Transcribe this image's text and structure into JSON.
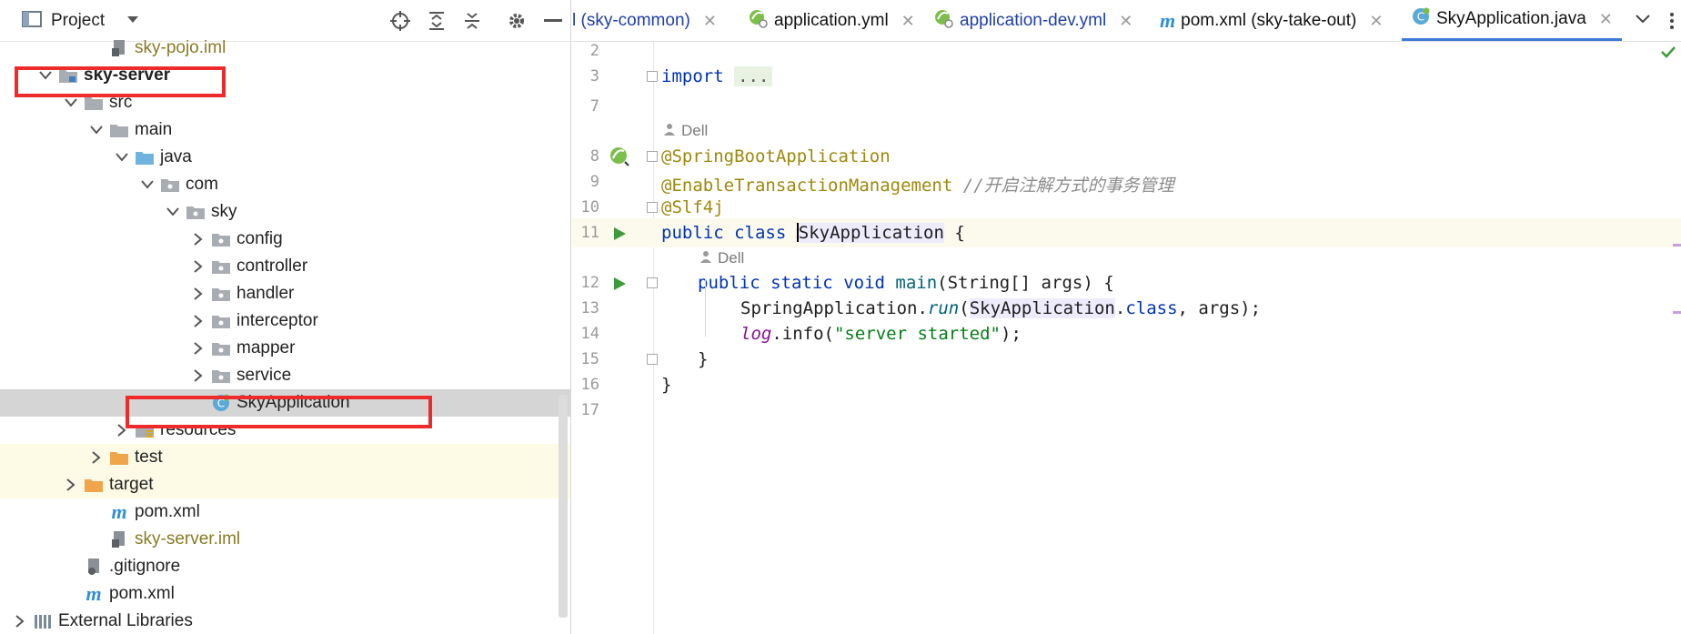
{
  "project_panel": {
    "title": "Project"
  },
  "tree": [
    {
      "label": "sky-pojo.iml",
      "depth": 3,
      "icon": "iml-file-icon",
      "expand": "none",
      "style": "olive"
    },
    {
      "label": "sky-server",
      "depth": 1,
      "icon": "module-folder-icon",
      "expand": "open",
      "style": "bold"
    },
    {
      "label": "src",
      "depth": 2,
      "icon": "folder-icon",
      "expand": "open",
      "style": "normal"
    },
    {
      "label": "main",
      "depth": 3,
      "icon": "folder-icon",
      "expand": "open",
      "style": "normal"
    },
    {
      "label": "java",
      "depth": 4,
      "icon": "source-folder-icon",
      "expand": "open",
      "style": "normal"
    },
    {
      "label": "com",
      "depth": 5,
      "icon": "package-icon",
      "expand": "open",
      "style": "normal"
    },
    {
      "label": "sky",
      "depth": 6,
      "icon": "package-icon",
      "expand": "open",
      "style": "normal"
    },
    {
      "label": "config",
      "depth": 7,
      "icon": "package-icon",
      "expand": "closed",
      "style": "normal"
    },
    {
      "label": "controller",
      "depth": 7,
      "icon": "package-icon",
      "expand": "closed",
      "style": "normal"
    },
    {
      "label": "handler",
      "depth": 7,
      "icon": "package-icon",
      "expand": "closed",
      "style": "normal"
    },
    {
      "label": "interceptor",
      "depth": 7,
      "icon": "package-icon",
      "expand": "closed",
      "style": "normal"
    },
    {
      "label": "mapper",
      "depth": 7,
      "icon": "package-icon",
      "expand": "closed",
      "style": "normal"
    },
    {
      "label": "service",
      "depth": 7,
      "icon": "package-icon",
      "expand": "closed",
      "style": "normal"
    },
    {
      "label": "SkyApplication",
      "depth": 7,
      "icon": "spring-class-icon",
      "expand": "none",
      "style": "normal",
      "selected": true
    },
    {
      "label": "resources",
      "depth": 4,
      "icon": "resources-folder-icon",
      "expand": "closed",
      "style": "normal"
    },
    {
      "label": "test",
      "depth": 3,
      "icon": "orange-folder-icon",
      "expand": "closed",
      "style": "normal",
      "yellow": true
    },
    {
      "label": "target",
      "depth": 2,
      "icon": "orange-folder-icon",
      "expand": "closed",
      "style": "normal",
      "yellow": true
    },
    {
      "label": "pom.xml",
      "depth": 3,
      "icon": "maven-icon",
      "expand": "none",
      "style": "normal"
    },
    {
      "label": "sky-server.iml",
      "depth": 3,
      "icon": "iml-file-icon",
      "expand": "none",
      "style": "olive"
    },
    {
      "label": ".gitignore",
      "depth": 2,
      "icon": "gitignore-icon",
      "expand": "none",
      "style": "normal"
    },
    {
      "label": "pom.xml",
      "depth": 2,
      "icon": "maven-icon",
      "expand": "none",
      "style": "normal"
    },
    {
      "label": "External Libraries",
      "depth": 0,
      "icon": "library-icon",
      "expand": "closed",
      "style": "normal"
    }
  ],
  "tabs": [
    {
      "label": "l (sky-common)",
      "icon": "",
      "active": false
    },
    {
      "label": "application.yml",
      "icon": "spring-yml-icon",
      "active": false
    },
    {
      "label": "application-dev.yml",
      "icon": "spring-yml-icon",
      "active": false
    },
    {
      "label": "pom.xml (sky-take-out)",
      "icon": "maven-icon",
      "active": false
    },
    {
      "label": "SkyApplication.java",
      "icon": "spring-class-icon",
      "active": true
    }
  ],
  "editor": {
    "line_numbers": [
      "2",
      "3",
      "7",
      "8",
      "9",
      "10",
      "11",
      "12",
      "13",
      "14",
      "15",
      "16",
      "17"
    ],
    "author_hint": "Dell",
    "import_keyword": "import",
    "import_folded": "...",
    "ann_spring_boot": "@SpringBootApplication",
    "ann_transaction": "@EnableTransactionManagement",
    "comment_transaction": "//开启注解方式的事务管理",
    "ann_slf4j": "@Slf4j",
    "kw_public": "public",
    "kw_class": "class",
    "class_name": "SkyApplication",
    "brace_open": "{",
    "brace_close": "}",
    "kw_static": "static",
    "kw_void": "void",
    "main_sig_name": "main",
    "main_sig_args": "(String[] args) {",
    "run_target": "SpringApplication",
    "run_method": "run",
    "run_arg_class": "SkyApplication",
    "kw_class_literal": "class",
    "run_rest": ", args);",
    "log_field": "log",
    "log_call": ".info(",
    "log_string": "\"server started\"",
    "log_end": ");",
    "dot": ".",
    "paren_open": "("
  },
  "colors": {
    "highlight_box": "#ee2a2a",
    "active_tab_underline": "#3c78d8"
  }
}
